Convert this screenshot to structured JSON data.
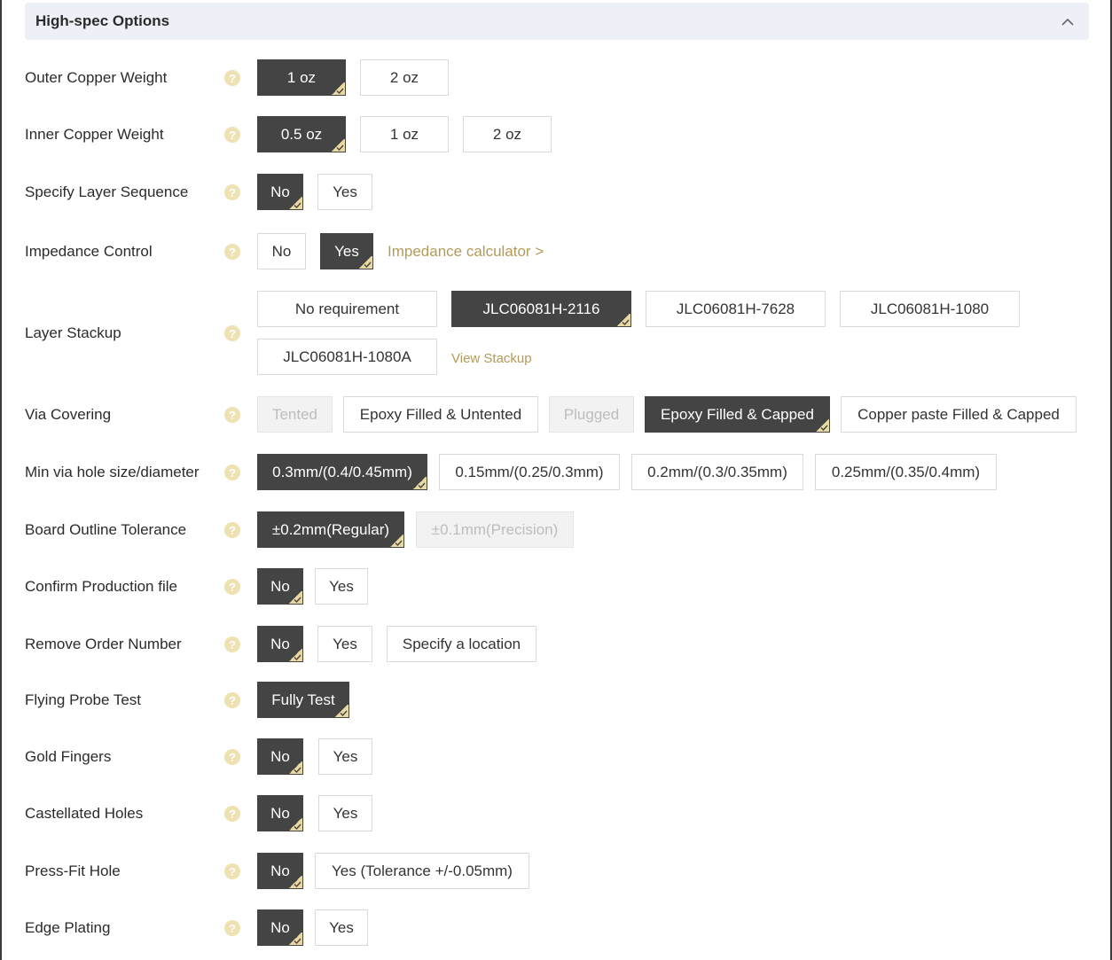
{
  "section": {
    "title": "High-spec Options"
  },
  "colors": {
    "selected": "#444444",
    "accent_gold": "#b39a57",
    "help_icon": "#eee2b2",
    "header_bg": "#eef0f7"
  },
  "rows": {
    "outer_copper": {
      "label": "Outer Copper Weight",
      "options": [
        "1 oz",
        "2 oz"
      ]
    },
    "inner_copper": {
      "label": "Inner Copper Weight",
      "options": [
        "0.5 oz",
        "1 oz",
        "2 oz"
      ]
    },
    "layer_sequence": {
      "label": "Specify Layer Sequence",
      "options": [
        "No",
        "Yes"
      ]
    },
    "impedance": {
      "label": "Impedance Control",
      "options": [
        "No",
        "Yes"
      ],
      "link": "Impedance calculator >"
    },
    "stackup": {
      "label": "Layer Stackup",
      "options": [
        "No requirement",
        "JLC06081H-2116",
        "JLC06081H-7628",
        "JLC06081H-1080",
        "JLC06081H-1080A"
      ],
      "link": "View Stackup"
    },
    "via_covering": {
      "label": "Via Covering",
      "options": [
        "Tented",
        "Epoxy Filled & Untented",
        "Plugged",
        "Epoxy Filled & Capped",
        "Copper paste Filled & Capped"
      ]
    },
    "min_via": {
      "label": "Min via hole size/diameter",
      "options": [
        "0.3mm/(0.4/0.45mm)",
        "0.15mm/(0.25/0.3mm)",
        "0.2mm/(0.3/0.35mm)",
        "0.25mm/(0.35/0.4mm)"
      ]
    },
    "outline_tolerance": {
      "label": "Board Outline Tolerance",
      "options": [
        "±0.2mm(Regular)",
        "±0.1mm(Precision)"
      ]
    },
    "confirm_file": {
      "label": "Confirm Production file",
      "options": [
        "No",
        "Yes"
      ]
    },
    "remove_order": {
      "label": "Remove Order Number",
      "options": [
        "No",
        "Yes",
        "Specify a location"
      ]
    },
    "flying_probe": {
      "label": "Flying Probe Test",
      "options": [
        "Fully Test"
      ]
    },
    "gold_fingers": {
      "label": "Gold Fingers",
      "options": [
        "No",
        "Yes"
      ]
    },
    "castellated": {
      "label": "Castellated Holes",
      "options": [
        "No",
        "Yes"
      ]
    },
    "press_fit": {
      "label": "Press-Fit Hole",
      "options": [
        "No",
        "Yes (Tolerance +/-0.05mm)"
      ]
    },
    "edge_plating": {
      "label": "Edge Plating",
      "options": [
        "No",
        "Yes"
      ]
    }
  },
  "help_glyph": "?"
}
